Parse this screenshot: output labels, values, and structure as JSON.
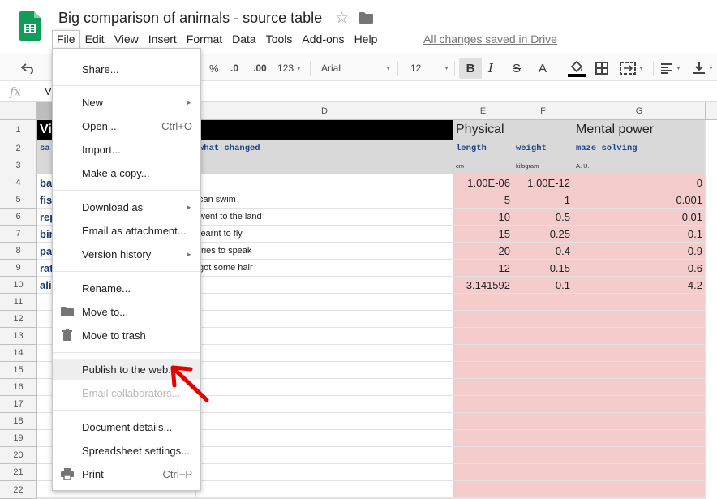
{
  "doc": {
    "title": "Big comparison of animals - source table",
    "save_status": "All changes saved in Drive"
  },
  "menubar": [
    "File",
    "Edit",
    "View",
    "Insert",
    "Format",
    "Data",
    "Tools",
    "Add-ons",
    "Help"
  ],
  "toolbar": {
    "percent": "%",
    "dec_decrease": ".0",
    "dec_increase": ".00",
    "more_formats": "123",
    "font": "Arial",
    "font_size": "12",
    "bold": "B"
  },
  "formula_bar": {
    "fx": "fx",
    "value": "Vi"
  },
  "columns": {
    "D": "D",
    "E": "E",
    "F": "F",
    "G": "G"
  },
  "rows": [
    "1",
    "2",
    "3",
    "4",
    "5",
    "6",
    "7",
    "8",
    "9",
    "10",
    "11",
    "12",
    "13",
    "14",
    "15",
    "16",
    "17",
    "18",
    "19",
    "20",
    "21",
    "22"
  ],
  "sheet": {
    "row1": {
      "A": "Vi",
      "E": "Physical",
      "G": "Mental power"
    },
    "row2": {
      "A": "sa",
      "D": "what changed",
      "E": "length",
      "F": "weight",
      "G": "maze solving"
    },
    "row3": {
      "E": "cm",
      "F": "kilogram",
      "G": "A. U."
    },
    "data": [
      {
        "A": "ba",
        "D": "",
        "E": "1.00E-06",
        "F": "1.00E-12",
        "G": "0"
      },
      {
        "A": "fis",
        "D": "can swim",
        "E": "5",
        "F": "1",
        "G": "0.001"
      },
      {
        "A": "rep",
        "D": "went to the land",
        "E": "10",
        "F": "0.5",
        "G": "0.01"
      },
      {
        "A": "bir",
        "D": "learnt to fly",
        "E": "15",
        "F": "0.25",
        "G": "0.1"
      },
      {
        "A": "pa",
        "D": "tries to speak",
        "E": "20",
        "F": "0.4",
        "G": "0.9"
      },
      {
        "A": "rat",
        "D": "got some hair",
        "E": "12",
        "F": "0.15",
        "G": "0.6"
      },
      {
        "A": "ali",
        "D": "",
        "E": "3.141592",
        "F": "-0.1",
        "G": "4.2"
      }
    ]
  },
  "file_menu": {
    "share": "Share...",
    "new": "New",
    "open": "Open...",
    "open_shortcut": "Ctrl+O",
    "import": "Import...",
    "copy": "Make a copy...",
    "download": "Download as",
    "email_attach": "Email as attachment...",
    "version": "Version history",
    "rename": "Rename...",
    "move": "Move to...",
    "trash": "Move to trash",
    "publish": "Publish to the web...",
    "email_collab": "Email collaborators...",
    "details": "Document details...",
    "settings": "Spreadsheet settings...",
    "print": "Print",
    "print_shortcut": "Ctrl+P"
  },
  "colors": {
    "pink_fill": "#f4cccc",
    "header_grey": "#d9d9d9",
    "sheets_green": "#0f9d58",
    "arrow_red": "#e60000"
  }
}
